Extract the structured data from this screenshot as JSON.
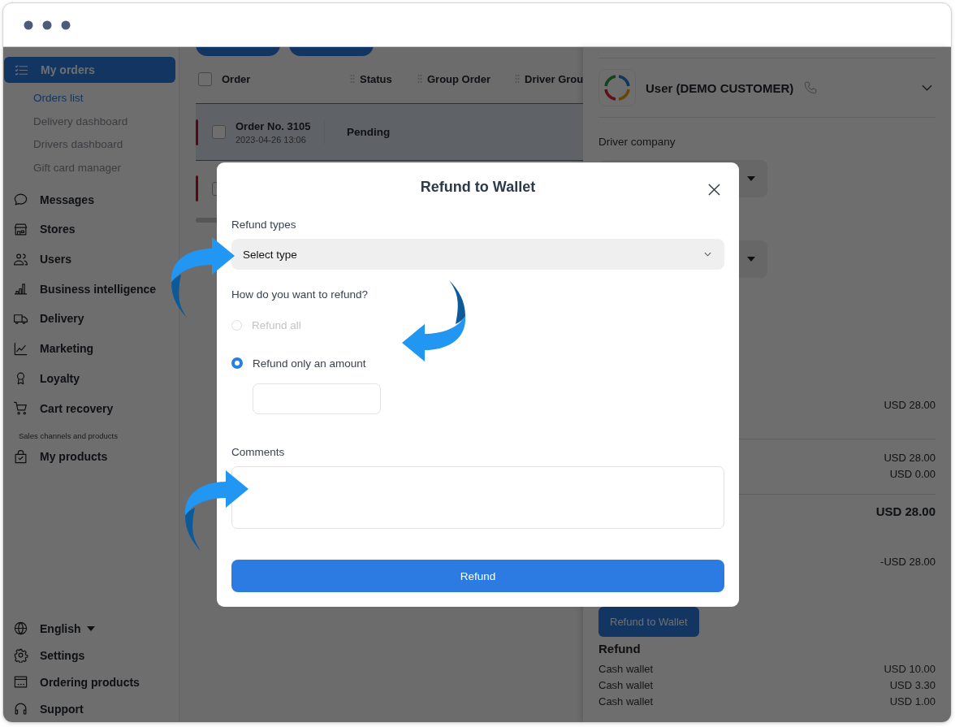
{
  "sidebar": {
    "items": [
      {
        "label": "My orders",
        "selected": true,
        "children": [
          {
            "label": "Orders list",
            "selected": true
          },
          {
            "label": "Delivery dashboard",
            "selected": false
          },
          {
            "label": "Drivers dashboard",
            "selected": false
          },
          {
            "label": "Gift card manager",
            "selected": false
          }
        ]
      },
      {
        "label": "Messages",
        "selected": false
      },
      {
        "label": "Stores",
        "selected": false
      },
      {
        "label": "Users",
        "selected": false
      },
      {
        "label": "Business intelligence",
        "selected": false
      },
      {
        "label": "Delivery",
        "selected": false
      },
      {
        "label": "Marketing",
        "selected": false
      },
      {
        "label": "Loyalty",
        "selected": false
      },
      {
        "label": "Cart recovery",
        "selected": false
      }
    ],
    "section_label": "Sales channels and products",
    "section_items": [
      {
        "label": "My products",
        "selected": false
      }
    ],
    "footer_items": [
      {
        "label": "English",
        "dropdown": true
      },
      {
        "label": "Settings"
      },
      {
        "label": "Ordering products"
      },
      {
        "label": "Support"
      }
    ]
  },
  "table": {
    "select_all_checked": false,
    "columns": [
      {
        "label": "Order",
        "handle": false
      },
      {
        "label": "Status",
        "handle": true
      },
      {
        "label": "Group Order",
        "handle": true
      },
      {
        "label": "Driver Grou",
        "handle": true
      }
    ],
    "rows": [
      {
        "order": "Order No. 3105",
        "date": "2023-04-26 13:06",
        "status": "Pending",
        "selected": true,
        "checked": false
      },
      {
        "selected": false
      }
    ]
  },
  "details": {
    "customer": {
      "name": "User (DEMO CUSTOMER)",
      "expanded": false
    },
    "driver_company_label": "Driver company",
    "summary_groups": [
      {
        "amounts": [
          {
            "text": "USD 28.00",
            "bold": false
          }
        ]
      },
      {
        "amounts": [
          {
            "text": "USD 28.00",
            "bold": false
          },
          {
            "text": "USD 0.00",
            "bold": false
          }
        ]
      },
      {
        "amounts": [
          {
            "text": "USD 28.00",
            "bold": true
          },
          {
            "text": "-USD 28.00",
            "bold": false
          }
        ]
      }
    ],
    "refund_button": "Refund to Wallet",
    "refund": {
      "title": "Refund",
      "rows": [
        {
          "label": "Cash wallet",
          "amount": "USD 10.00"
        },
        {
          "label": "Cash wallet",
          "amount": "USD 3.30"
        },
        {
          "label": "Cash wallet",
          "amount": "USD 1.00"
        }
      ]
    }
  },
  "modal": {
    "title": "Refund to Wallet",
    "type_label": "Refund types",
    "type_select": {
      "value": "Select type"
    },
    "question": "How do you want to refund?",
    "options": [
      {
        "label": "Refund all",
        "selected": false,
        "disabled": true
      },
      {
        "label": "Refund only an amount",
        "selected": true,
        "disabled": false
      }
    ],
    "comments_label": "Comments",
    "submit": "Refund"
  }
}
